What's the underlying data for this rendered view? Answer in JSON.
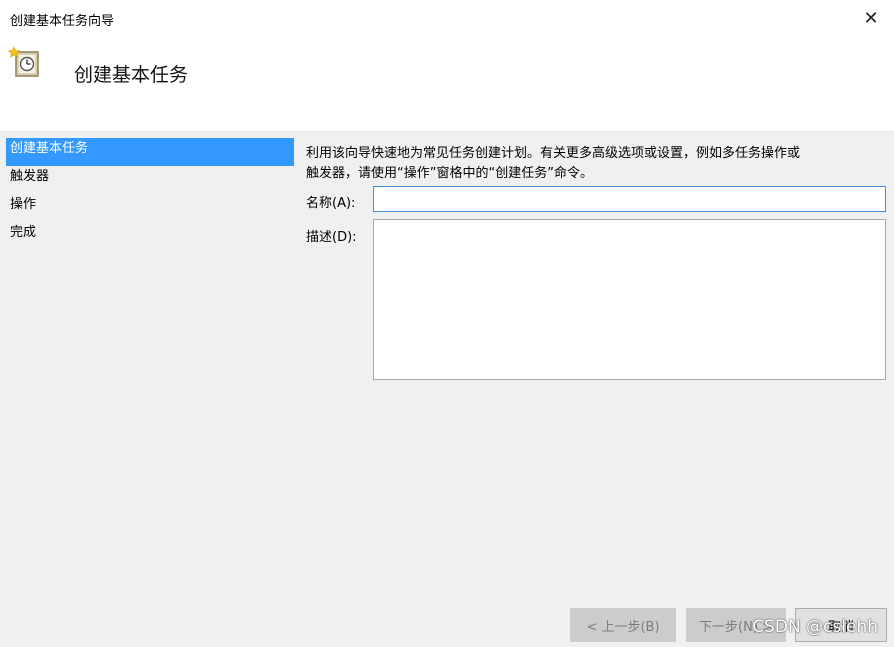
{
  "window": {
    "title": "创建基本任务向导"
  },
  "header": {
    "title": "创建基本任务",
    "icon": "task-clock-icon"
  },
  "sidebar": {
    "items": [
      {
        "label": "创建基本任务",
        "active": true
      },
      {
        "label": "触发器",
        "active": false
      },
      {
        "label": "操作",
        "active": false
      },
      {
        "label": "完成",
        "active": false
      }
    ]
  },
  "main": {
    "intro_line1": "利用该向导快速地为常见任务创建计划。有关更多高级选项或设置，例如多任务操作或",
    "intro_line2": "触发器，请使用“操作”窗格中的“创建任务”命令。",
    "name_label": "名称(A):",
    "name_value": "",
    "desc_label": "描述(D):",
    "desc_value": ""
  },
  "buttons": {
    "back": "< 上一步(B)",
    "next": "下一步(N) >",
    "cancel": "取消"
  },
  "watermark": "CSDN @cslehh",
  "colors": {
    "accent": "#3399ff",
    "content_bg": "#f0f0f0",
    "focus_border": "#3c8fd8"
  }
}
